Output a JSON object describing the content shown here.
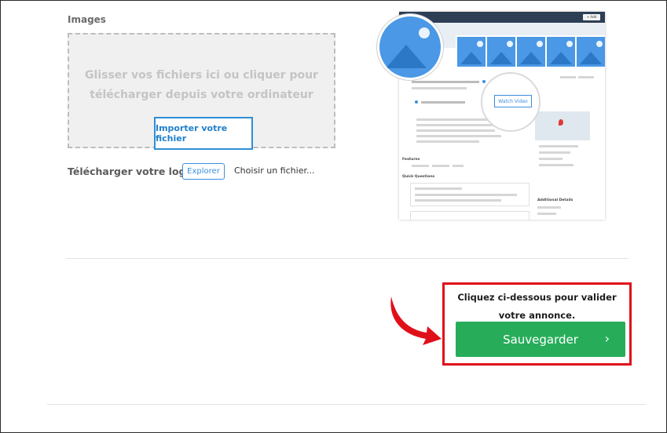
{
  "images": {
    "label": "Images",
    "dropzone_text": "Glisser vos fichiers ici ou cliquer pour télécharger depuis votre ordinateur",
    "import_button": "Importer votre fichier"
  },
  "logo": {
    "label": "Télécharger votre logo",
    "browse_button": "Explorer",
    "file_status": "Choisir un fichier..."
  },
  "preview": {
    "watch_video": "Watch Video",
    "features": "Features",
    "quick_questions": "Quick Questions",
    "additional_details": "Additional Details",
    "add_listing": "+ Add Listing"
  },
  "cta": {
    "instruction": "Cliquez ci-dessous pour valider votre annonce.",
    "save_button": "Sauvegarder"
  },
  "colors": {
    "save_green": "#27ad5a",
    "highlight_red": "#e0101a",
    "link_blue": "#2d8fd6"
  }
}
